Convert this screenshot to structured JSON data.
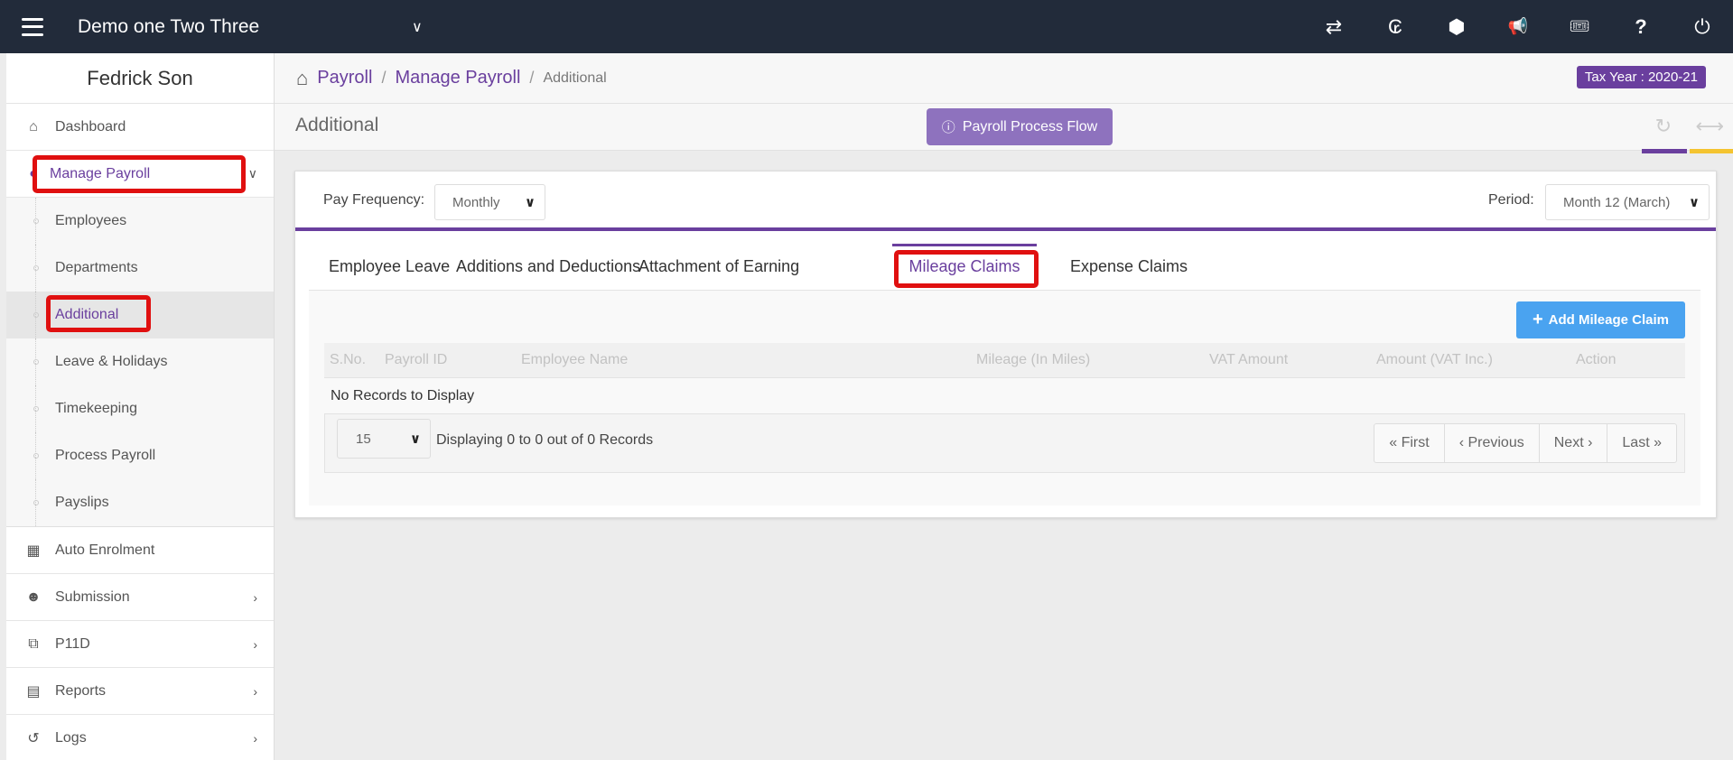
{
  "topbar": {
    "company": "Demo one Two Three",
    "icons": [
      "transfer-icon",
      "currency-icon",
      "cubes-icon",
      "megaphone-icon",
      "ticket-icon",
      "help-icon",
      "power-icon"
    ],
    "icon_glyphs": [
      "⇄",
      "₢",
      "⬢",
      "📢",
      "🎟",
      "?",
      "⏻"
    ]
  },
  "sidebar": {
    "user": "Fedrick Son",
    "dashboard": "Dashboard",
    "manage_payroll": "Manage Payroll",
    "sub_items": [
      "Employees",
      "Departments",
      "Additional",
      "Leave & Holidays",
      "Timekeeping",
      "Process Payroll",
      "Payslips"
    ],
    "bottom_items": [
      "Auto Enrolment",
      "Submission",
      "P11D",
      "Reports",
      "Logs"
    ]
  },
  "breadcrumb": {
    "items": [
      "Payroll",
      "Manage Payroll"
    ],
    "current": "Additional",
    "separator": "/"
  },
  "tax_year": "Tax Year : 2020-21",
  "page": {
    "title": "Additional",
    "process_flow_button": "Payroll Process Flow"
  },
  "filters": {
    "pay_frequency_label": "Pay Frequency:",
    "pay_frequency_value": "Monthly",
    "period_label": "Period:",
    "period_value": "Month 12 (March)"
  },
  "tabs": [
    "Employee Leave",
    "Additions and Deductions",
    "Attachment of Earning",
    "Mileage Claims",
    "Expense Claims"
  ],
  "add_button": "Add Mileage Claim",
  "table": {
    "columns": [
      "S.No.",
      "Payroll ID",
      "Employee Name",
      "Mileage (In Miles)",
      "VAT Amount",
      "Amount (VAT Inc.)",
      "Action"
    ],
    "empty_message": "No Records to Display"
  },
  "pager": {
    "page_size": "15",
    "display_text": "Displaying 0 to 0 out of 0 Records",
    "first": "« First",
    "previous": "‹ Previous",
    "next": "Next ›",
    "last": "Last »"
  },
  "colors": {
    "topbar": "#222b3a",
    "accent": "#6a3f9e",
    "process_flow_button": "#8e72be",
    "add_button": "#4aa3f0",
    "highlight": "#e01010",
    "yellow_bar": "#f4c430"
  }
}
